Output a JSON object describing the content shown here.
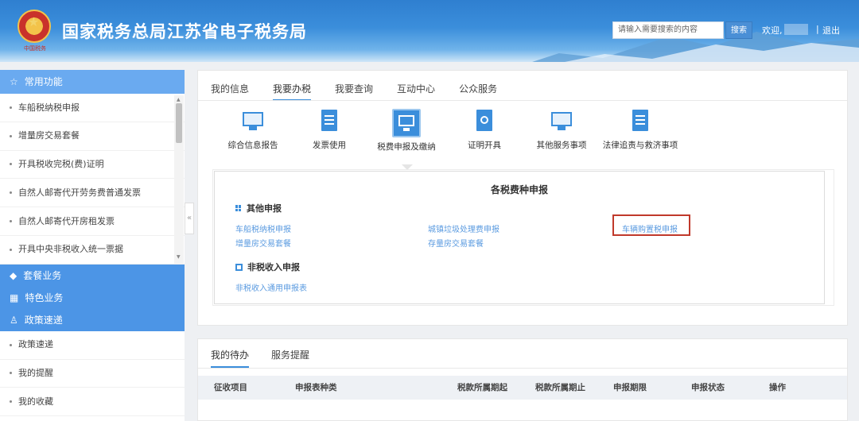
{
  "header": {
    "emblem_text": "中国税务",
    "title": "国家税务总局江苏省电子税务局",
    "search_placeholder": "请输入需要搜索的内容",
    "search_button": "搜索",
    "welcome": "欢迎,",
    "separator": "|",
    "logout": "退出"
  },
  "sidebar": {
    "common_title": "常用功能",
    "common_items": [
      "车船税纳税申报",
      "增量房交易套餐",
      "开具税收完税(费)证明",
      "自然人邮寄代开劳务费普通发票",
      "自然人邮寄代开房租发票",
      "开具中央非税收入统一票据"
    ],
    "package_title": "套餐业务",
    "feature_title": "特色业务",
    "policy_title": "政策速递",
    "bottom_items": [
      "政策速递",
      "我的提醒",
      "我的收藏"
    ],
    "collapse": "«"
  },
  "main": {
    "tabs": [
      "我的信息",
      "我要办税",
      "我要查询",
      "互动中心",
      "公众服务"
    ],
    "active_tab": 1,
    "functions": [
      {
        "label": "综合信息报告",
        "icon": "chart-monitor-icon"
      },
      {
        "label": "发票使用",
        "icon": "invoice-document-icon"
      },
      {
        "label": "税费申报及缴纳",
        "icon": "tax-declare-monitor-icon"
      },
      {
        "label": "证明开具",
        "icon": "certificate-document-icon"
      },
      {
        "label": "其他服务事项",
        "icon": "service-monitor-icon"
      },
      {
        "label": "法律追责与救济事项",
        "icon": "legal-document-icon"
      }
    ],
    "declare_panel": {
      "title": "各税费种申报",
      "section1_title": "其他申报",
      "section1_links": [
        "车船税纳税申报",
        "增量房交易套餐",
        "城镇垃圾处理费申报",
        "存量房交易套餐",
        "车辆购置税申报"
      ],
      "section2_title": "非税收入申报",
      "section2_links": [
        "非税收入通用申报表"
      ]
    }
  },
  "todo": {
    "tabs": [
      "我的待办",
      "服务提醒"
    ],
    "active_tab": 0,
    "columns": [
      "征收项目",
      "申报表种类",
      "税款所属期起",
      "税款所属期止",
      "申报期限",
      "申报状态",
      "操作"
    ]
  }
}
